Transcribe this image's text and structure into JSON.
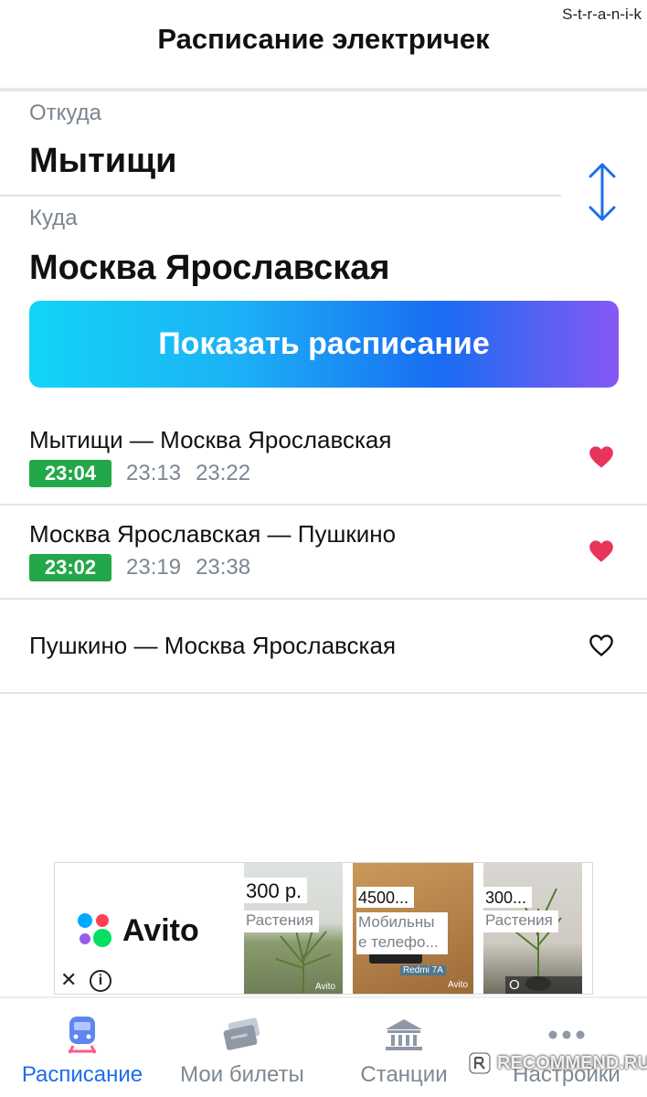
{
  "watermark_top": "S-t-r-a-n-i-k",
  "header": {
    "title": "Расписание электричек"
  },
  "route_form": {
    "from_label": "Откуда",
    "from_value": "Мытищи",
    "to_label": "Куда",
    "to_value": "Москва Ярославская",
    "show_button_label": "Показать расписание"
  },
  "favorites": [
    {
      "route": "Мытищи — Москва Ярославская",
      "next_time": "23:04",
      "times": [
        "23:13",
        "23:22"
      ],
      "favorite": true
    },
    {
      "route": "Москва Ярославская — Пушкино",
      "next_time": "23:02",
      "times": [
        "23:19",
        "23:38"
      ],
      "favorite": true
    },
    {
      "route": "Пушкино — Москва Ярославская",
      "next_time": "",
      "times": [],
      "favorite": false
    }
  ],
  "ad": {
    "brand": "Avito",
    "cards": [
      {
        "price": "300 р.",
        "category": "Растения"
      },
      {
        "price": "4500...",
        "category": "Мобильны",
        "category2": "е телефо...",
        "phone_label": "Redmi 7A"
      },
      {
        "price": "300...",
        "category": "Растения",
        "company_label": "О компании"
      }
    ],
    "close_icon": "close-icon",
    "info_icon": "info-icon",
    "small_brand": "Avito"
  },
  "tabs": [
    {
      "label": "Расписание",
      "icon": "train-icon",
      "active": true
    },
    {
      "label": "Мои билеты",
      "icon": "ticket-icon",
      "active": false
    },
    {
      "label": "Станции",
      "icon": "station-icon",
      "active": false
    },
    {
      "label": "Настройки",
      "icon": "more-icon",
      "active": false
    }
  ],
  "watermark_bottom": "RECOMMEND.RU",
  "colors": {
    "accent_blue": "#1c6fe8",
    "badge_green": "#22a84a",
    "heart_red": "#e8345a"
  }
}
